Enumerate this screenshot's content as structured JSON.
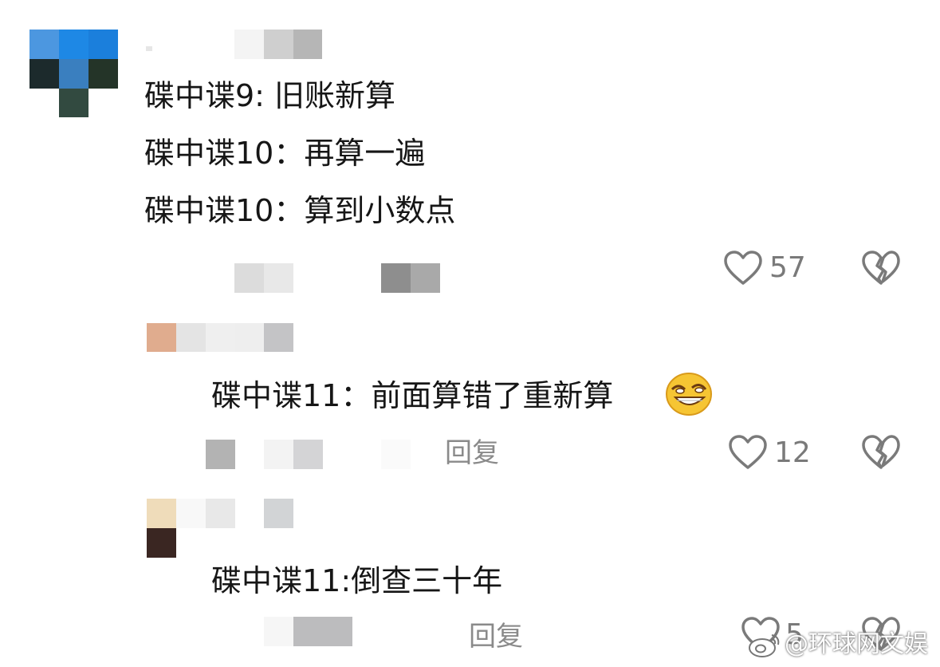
{
  "comments": [
    {
      "lines": [
        "碟中谍9: 旧账新算",
        "碟中谍10：再算一遍",
        "碟中谍10：算到小数点"
      ],
      "likes": "57"
    },
    {
      "text": "碟中谍11：前面算错了重新算",
      "reply_label": "回复",
      "likes": "12"
    },
    {
      "text": "碟中谍11:倒查三十年",
      "reply_label": "回复",
      "likes": "5"
    }
  ],
  "watermark": "@环球网文娱",
  "icons": {
    "like": "heart-outline-icon",
    "dislike": "broken-heart-icon",
    "emoji": "grinning-squint-emoji-icon"
  },
  "colors": {
    "text": "#161616",
    "meta": "#8a8a8a",
    "icon": "#7a7a7a",
    "emoji_yellow": "#f6c533"
  }
}
